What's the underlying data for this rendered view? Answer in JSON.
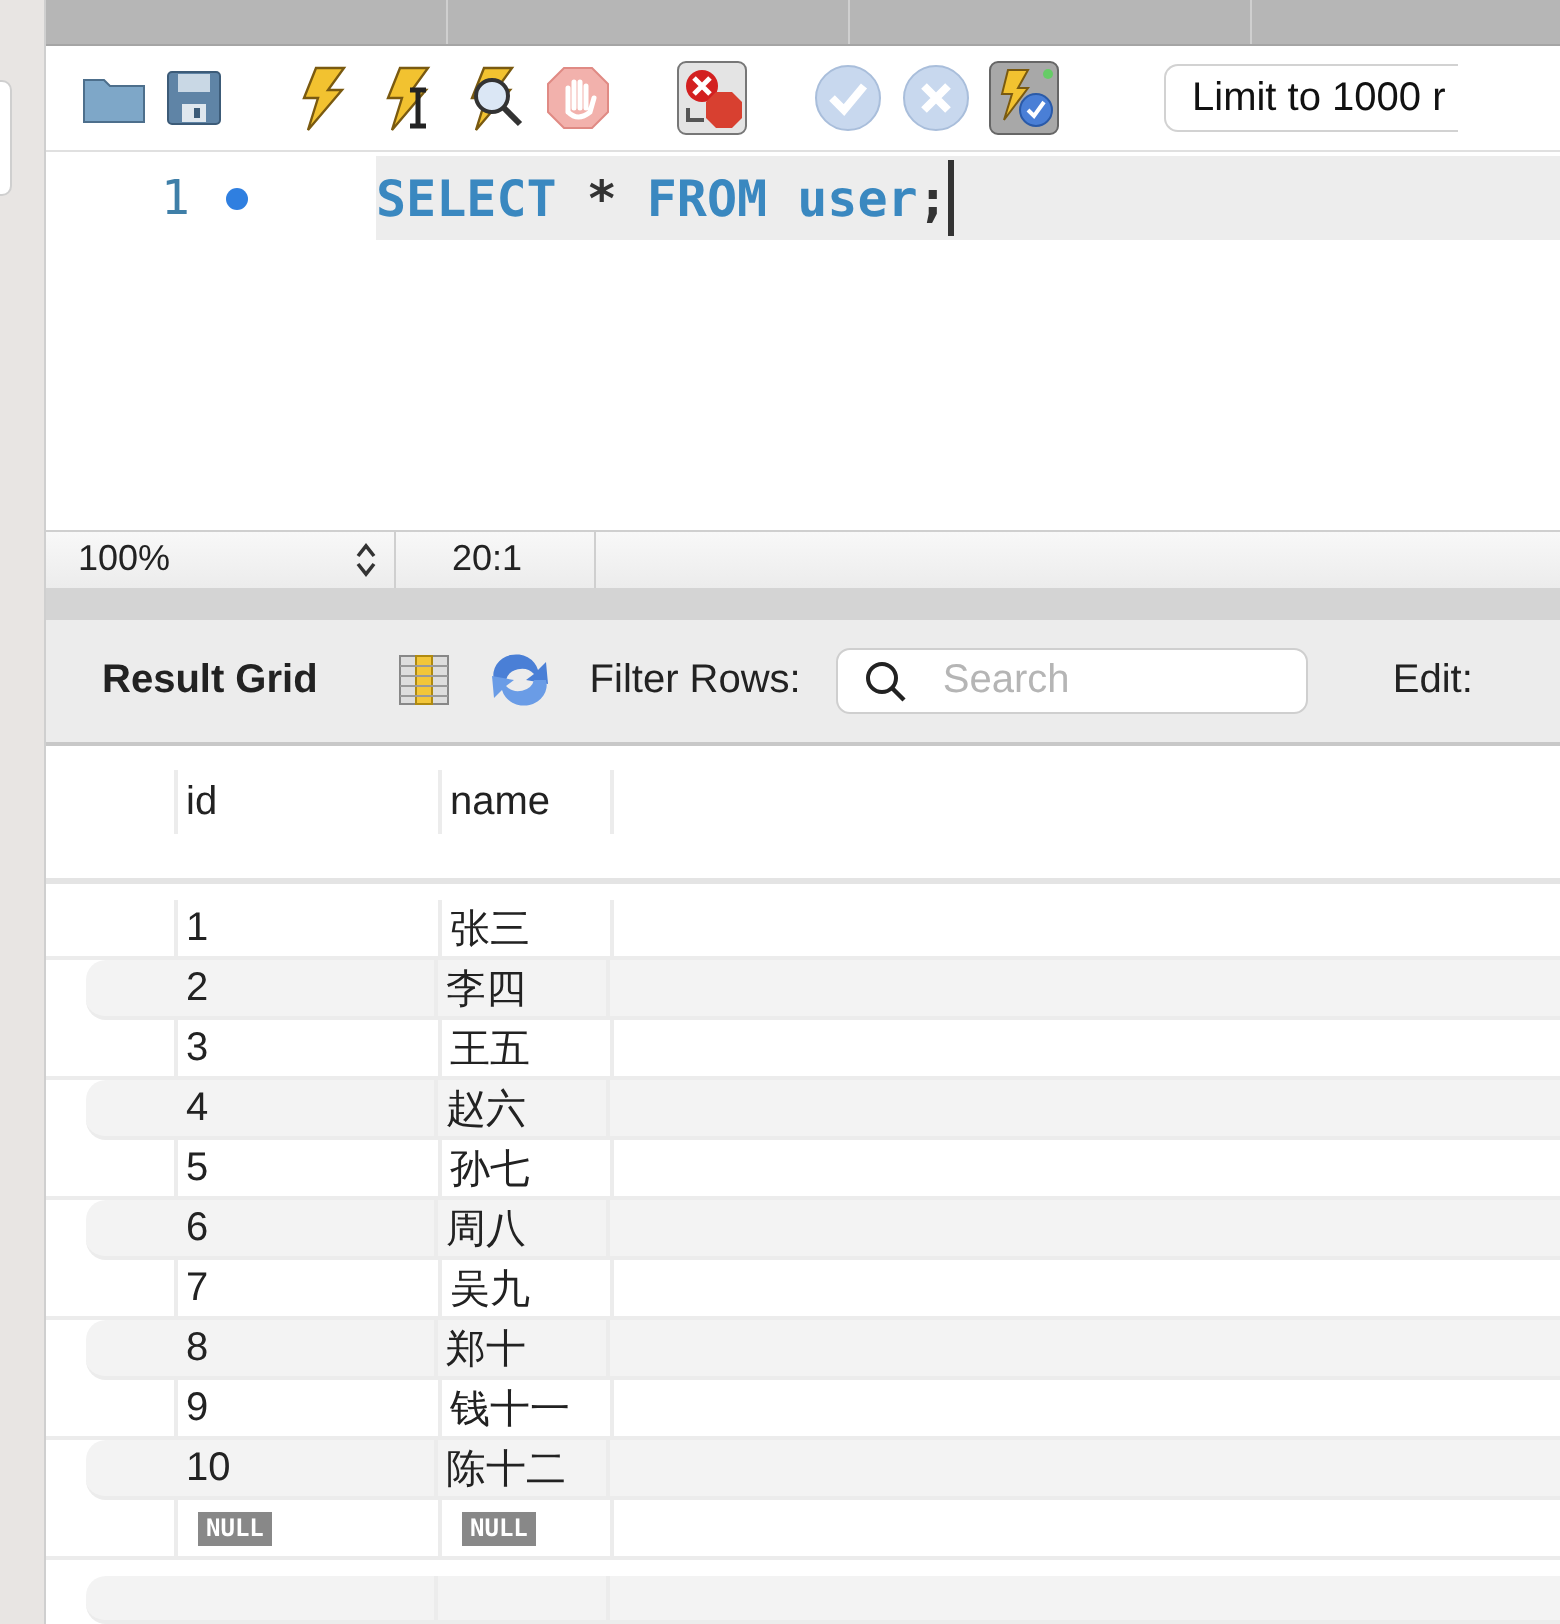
{
  "toolbar": {
    "limit": "Limit to 1000 r"
  },
  "editor": {
    "lines": [
      {
        "number": "1",
        "statement_marker": true,
        "current": true,
        "tokens": [
          {
            "text": "SELECT",
            "kind": "keyword"
          },
          {
            "text": "*",
            "kind": "operator"
          },
          {
            "text": "FROM",
            "kind": "keyword"
          },
          {
            "text": "user",
            "kind": "keyword"
          },
          {
            "text": ";",
            "kind": "punctuation"
          }
        ]
      }
    ]
  },
  "status_bar": {
    "zoom": "100%",
    "position": "20:1"
  },
  "result_toolbar": {
    "title": "Result Grid",
    "filter_label": "Filter Rows:",
    "search": {
      "placeholder": "Search"
    },
    "edit_label": "Edit:"
  },
  "table": {
    "columns": [
      "id",
      "name"
    ],
    "rows": [
      {
        "cells": [
          {
            "text": "1",
            "kind": "value"
          },
          {
            "text": "张三",
            "kind": "value"
          }
        ]
      },
      {
        "cells": [
          {
            "text": "2",
            "kind": "value"
          },
          {
            "text": "李四",
            "kind": "value"
          }
        ]
      },
      {
        "cells": [
          {
            "text": "3",
            "kind": "value"
          },
          {
            "text": "王五",
            "kind": "value"
          }
        ]
      },
      {
        "cells": [
          {
            "text": "4",
            "kind": "value"
          },
          {
            "text": "赵六",
            "kind": "value"
          }
        ]
      },
      {
        "cells": [
          {
            "text": "5",
            "kind": "value"
          },
          {
            "text": "孙七",
            "kind": "value"
          }
        ]
      },
      {
        "cells": [
          {
            "text": "6",
            "kind": "value"
          },
          {
            "text": "周八",
            "kind": "value"
          }
        ]
      },
      {
        "cells": [
          {
            "text": "7",
            "kind": "value"
          },
          {
            "text": "吴九",
            "kind": "value"
          }
        ]
      },
      {
        "cells": [
          {
            "text": "8",
            "kind": "value"
          },
          {
            "text": "郑十",
            "kind": "value"
          }
        ]
      },
      {
        "cells": [
          {
            "text": "9",
            "kind": "value"
          },
          {
            "text": "钱十一",
            "kind": "value"
          }
        ]
      },
      {
        "cells": [
          {
            "text": "10",
            "kind": "value"
          },
          {
            "text": "陈十二",
            "kind": "value"
          }
        ]
      },
      {
        "cells": [
          {
            "text": "NULL",
            "kind": "null"
          },
          {
            "text": "NULL",
            "kind": "null"
          }
        ]
      }
    ]
  }
}
